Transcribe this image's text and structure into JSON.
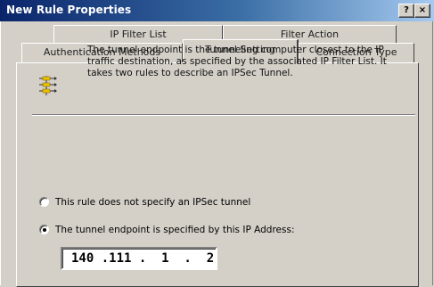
{
  "window": {
    "title": "New Rule Properties",
    "help_button": "?",
    "close_button": "×"
  },
  "tabs": {
    "back_row": [
      "IP Filter List",
      "Filter Action"
    ],
    "front_row": [
      "Authentication Methods",
      "Tunnel Setting",
      "Connection Type"
    ],
    "selected": "Tunnel Setting"
  },
  "info": {
    "icon": "tunnel-endpoint-icon",
    "description": "The tunnel endpoint is the tunneling computer closest to the IP traffic destination, as specified by the associated IP Filter List. It takes two rules to describe an IPSec Tunnel."
  },
  "options": [
    {
      "label": "This rule does not specify an IPSec tunnel",
      "checked": false
    },
    {
      "label": "The tunnel endpoint is specified by this IP Address:",
      "checked": true
    }
  ],
  "ip_address": {
    "display": "140 .111 .  1  .  2",
    "octets": [
      "140",
      "111",
      "1",
      "2"
    ]
  },
  "colors": {
    "titlebar_start": "#0a246a",
    "titlebar_end": "#a6caf0",
    "dialog_background": "#d4d0c8",
    "icon_accent": "#e8c000"
  }
}
